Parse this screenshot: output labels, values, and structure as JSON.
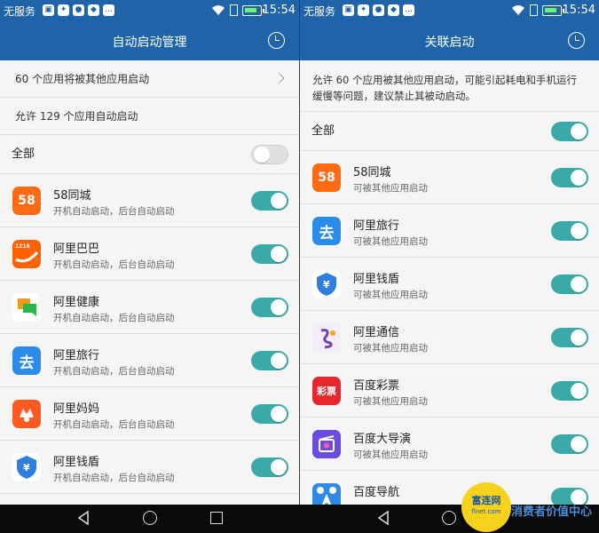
{
  "status_bar": {
    "carrier": "无服务",
    "time": "15:54"
  },
  "left": {
    "title": "自动启动管理",
    "info_rows": [
      {
        "label": "60 个应用将被其他应用启动"
      },
      {
        "label": "允许 129 个应用自动启动"
      }
    ],
    "all": {
      "label": "全部",
      "on": false
    },
    "apps": [
      {
        "name": "58同城",
        "sub": "开机自动启动，后台自动启动",
        "icon": "58-tongcheng-icon",
        "on": true
      },
      {
        "name": "阿里巴巴",
        "sub": "开机自动启动，后台自动启动",
        "icon": "alibaba-icon",
        "on": true
      },
      {
        "name": "阿里健康",
        "sub": "开机自动启动，后台自动启动",
        "icon": "ali-health-icon",
        "on": true
      },
      {
        "name": "阿里旅行",
        "sub": "开机自动启动，后台自动启动",
        "icon": "ali-travel-icon",
        "on": true
      },
      {
        "name": "阿里妈妈",
        "sub": "开机自动启动，后台自动启动",
        "icon": "ali-mama-icon",
        "on": true
      },
      {
        "name": "阿里钱盾",
        "sub": "开机自动启动，后台自动启动",
        "icon": "ali-qiandun-icon",
        "on": true
      }
    ]
  },
  "right": {
    "title": "关联启动",
    "description": "允许 60 个应用被其他应用启动，可能引起耗电和手机运行缓慢等问题，建议禁止其被动启动。",
    "all": {
      "label": "全部",
      "on": true
    },
    "apps": [
      {
        "name": "58同城",
        "sub": "可被其他应用启动",
        "icon": "58-tongcheng-icon",
        "on": true
      },
      {
        "name": "阿里旅行",
        "sub": "可被其他应用启动",
        "icon": "ali-travel-icon",
        "on": true
      },
      {
        "name": "阿里钱盾",
        "sub": "可被其他应用启动",
        "icon": "ali-qiandun-icon",
        "on": true
      },
      {
        "name": "阿里通信",
        "sub": "可被其他应用启动",
        "icon": "ali-tongxin-icon",
        "on": true
      },
      {
        "name": "百度彩票",
        "sub": "可被其他应用启动",
        "icon": "baidu-lottery-icon",
        "on": true
      },
      {
        "name": "百度大导演",
        "sub": "可被其他应用启动",
        "icon": "baidu-director-icon",
        "on": true
      },
      {
        "name": "百度导航",
        "sub": "",
        "icon": "baidu-navi-icon",
        "on": true
      }
    ]
  },
  "icon_text": {
    "tongcheng": "58",
    "travel": "去",
    "lottery": "彩票"
  },
  "watermark": {
    "circle_line1": "富连网",
    "circle_line2": "flnet.com",
    "text": "消费者价值中心"
  },
  "colors": {
    "header": "#1f64a8",
    "toggle_on": "#3aa9a9",
    "toggle_off": "#e0e0e0",
    "navbar": "#0a0a0a"
  }
}
